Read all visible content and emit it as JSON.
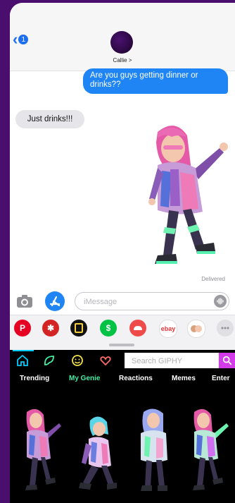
{
  "header": {
    "back_count": "1",
    "contact_name": "Callie >"
  },
  "messages": {
    "outgoing": "Are you guys getting dinner or drinks??",
    "incoming": "Just drinks!!!",
    "status": "Delivered"
  },
  "composer": {
    "placeholder": "iMessage"
  },
  "app_strip": {
    "apps": [
      "pinterest-icon",
      "yelp-icon",
      "notes-icon",
      "cash-icon",
      "game-icon",
      "ebay-icon",
      "memoji-icon",
      "more-icon"
    ],
    "ebay_label": "ebay"
  },
  "giphy": {
    "search_placeholder": "Search GIPHY",
    "tabs": [
      "Trending",
      "My Genie",
      "Reactions",
      "Memes",
      "Enter"
    ],
    "active_tab": "My Genie"
  },
  "colors": {
    "imessage_blue": "#1f85f5",
    "giphy_active_tab": "#44f0a5",
    "giphy_search_button": "#d13be8",
    "giphy_home_accent": "#00ccff"
  }
}
